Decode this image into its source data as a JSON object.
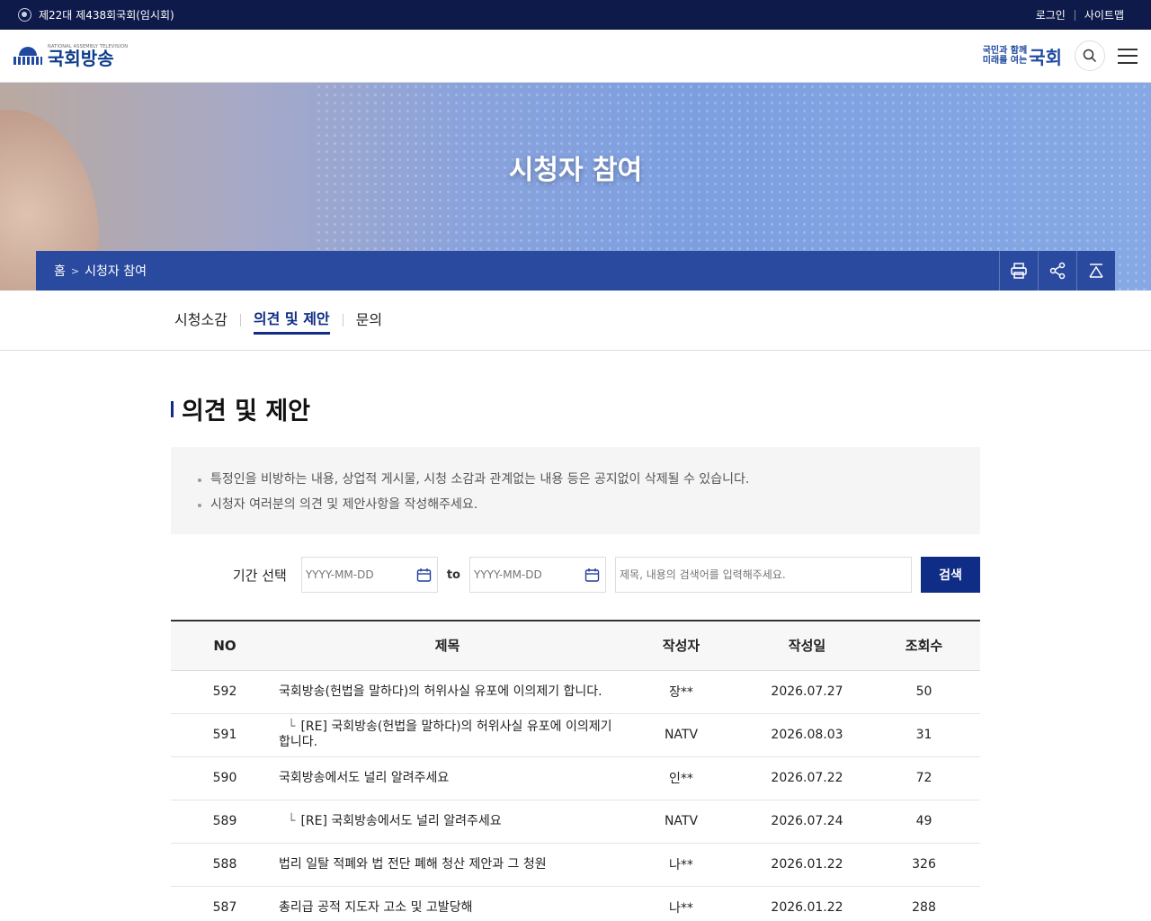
{
  "topbar": {
    "session": "제22대 제438회국회(임시회)",
    "login": "로그인",
    "sitemap": "사이트맵"
  },
  "header": {
    "logo_sub": "NATIONAL ASSEMBLY TELEVISION",
    "logo_main": "국회방송",
    "slogan_line1": "국민과 함께",
    "slogan_line2": "미래를 여는",
    "slogan_big": "국회"
  },
  "banner": {
    "title": "시청자 참여"
  },
  "breadcrumb": {
    "home": "홈",
    "current": "시청자 참여"
  },
  "tabs": [
    {
      "label": "시청소감"
    },
    {
      "label": "의견 및 제안"
    },
    {
      "label": "문의"
    }
  ],
  "page": {
    "heading": "의견 및 제안",
    "notices": [
      "특정인을 비방하는 내용, 상업적 게시물, 시청 소감과 관계없는 내용 등은 공지없이 삭제될 수 있습니다.",
      "시청자 여러분의 의견 및 제안사항을 작성해주세요."
    ]
  },
  "search": {
    "period_label": "기간 선택",
    "date_from_placeholder": "YYYY-MM-DD",
    "to_label": "to",
    "date_to_placeholder": "YYYY-MM-DD",
    "keyword_placeholder": "제목, 내용의 검색어를 입력해주세요.",
    "button": "검색"
  },
  "table": {
    "headers": [
      "NO",
      "제목",
      "작성자",
      "작성일",
      "조회수"
    ],
    "rows": [
      {
        "no": "592",
        "title": "국회방송(헌법을 말하다)의 허위사실 유포에 이의제기 합니다.",
        "reply": false,
        "author": "장**",
        "date": "2026.07.27",
        "views": "50"
      },
      {
        "no": "591",
        "title": "[RE] 국회방송(헌법을 말하다)의 허위사실 유포에 이의제기 합니다.",
        "reply": true,
        "author": "NATV",
        "date": "2026.08.03",
        "views": "31"
      },
      {
        "no": "590",
        "title": "국회방송에서도 널리 알려주세요",
        "reply": false,
        "author": "인**",
        "date": "2026.07.22",
        "views": "72"
      },
      {
        "no": "589",
        "title": "[RE] 국회방송에서도 널리 알려주세요",
        "reply": true,
        "author": "NATV",
        "date": "2026.07.24",
        "views": "49"
      },
      {
        "no": "588",
        "title": "법리 일탈 적폐와 법 전단 폐해 청산 제안과 그 청원",
        "reply": false,
        "author": "나**",
        "date": "2026.01.22",
        "views": "326"
      },
      {
        "no": "587",
        "title": "총리급 공적 지도자 고소 및 고발당해",
        "reply": false,
        "author": "나**",
        "date": "2026.01.22",
        "views": "288"
      }
    ]
  }
}
